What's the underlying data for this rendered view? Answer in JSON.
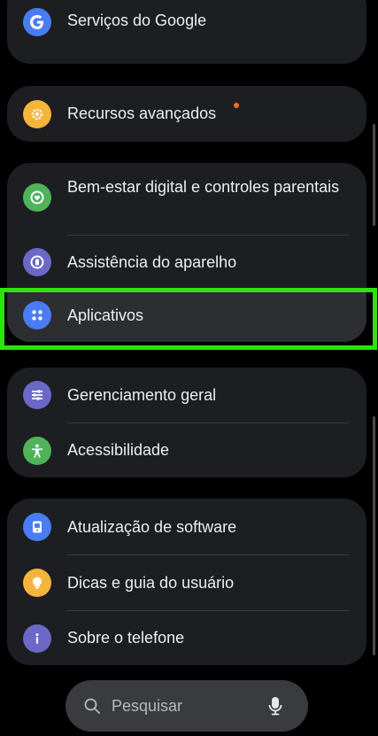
{
  "sections": [
    {
      "items": [
        {
          "label": "Serviços do Google",
          "icon": "google-icon",
          "icon_color": "#4a7df5"
        }
      ]
    },
    {
      "items": [
        {
          "label": "Recursos avançados",
          "icon": "gear-star-icon",
          "icon_color": "#f5b43b",
          "badge_color": "#ff6a2a"
        }
      ]
    },
    {
      "items": [
        {
          "label": "Bem-estar digital e controles parentais",
          "icon": "heart-icon",
          "icon_color": "#4fb35a"
        },
        {
          "label": "Assistência do aparelho",
          "icon": "device-care-icon",
          "icon_color": "#6b68c7"
        },
        {
          "label": "Aplicativos",
          "icon": "apps-icon",
          "icon_color": "#4a7df5"
        }
      ]
    },
    {
      "items": [
        {
          "label": "Gerenciamento geral",
          "icon": "sliders-icon",
          "icon_color": "#6b68c7"
        },
        {
          "label": "Acessibilidade",
          "icon": "accessibility-icon",
          "icon_color": "#4fb35a"
        }
      ]
    },
    {
      "items": [
        {
          "label": "Atualização de software",
          "icon": "software-update-icon",
          "icon_color": "#4a7df5"
        },
        {
          "label": "Dicas e guia do usuário",
          "icon": "lightbulb-icon",
          "icon_color": "#f5b43b"
        },
        {
          "label": "Sobre o telefone",
          "icon": "info-icon",
          "icon_color": "#6b68c7"
        }
      ]
    }
  ],
  "search": {
    "placeholder": "Pesquisar"
  },
  "colors": {
    "highlight": "#2ee10f",
    "card_bg": "#1d1e21",
    "background": "#000000"
  }
}
